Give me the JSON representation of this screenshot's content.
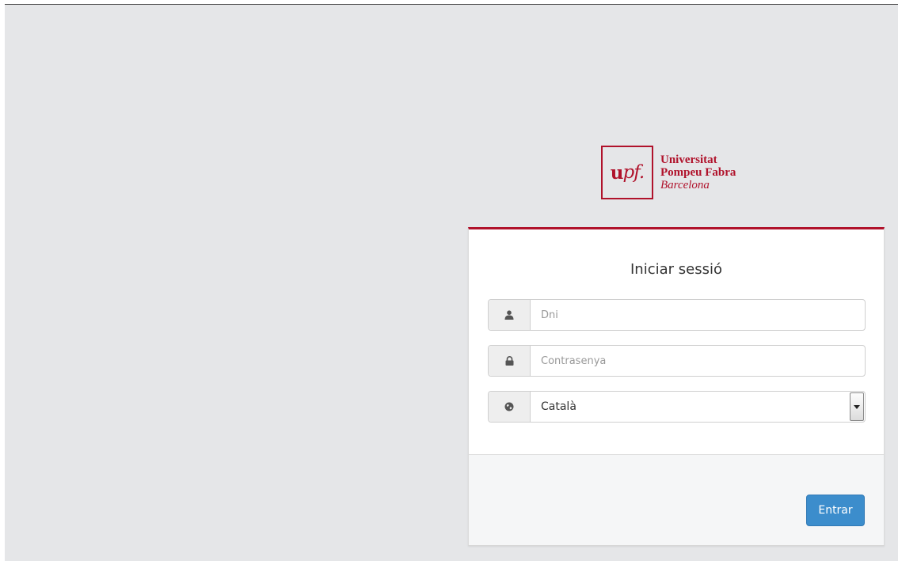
{
  "logo": {
    "mark_u": "u",
    "mark_pf": "pf.",
    "line1": "Universitat",
    "line2": "Pompeu Fabra",
    "line3": "Barcelona",
    "brand_color": "#b0122b"
  },
  "login": {
    "title": "Iniciar sessió",
    "username": {
      "placeholder": "Dni",
      "value": "",
      "icon": "user-icon"
    },
    "password": {
      "placeholder": "Contrasenya",
      "value": "",
      "icon": "lock-icon"
    },
    "language": {
      "selected": "Català",
      "icon": "globe-icon"
    },
    "submit_label": "Entrar",
    "button_color": "#3c8dcc"
  }
}
